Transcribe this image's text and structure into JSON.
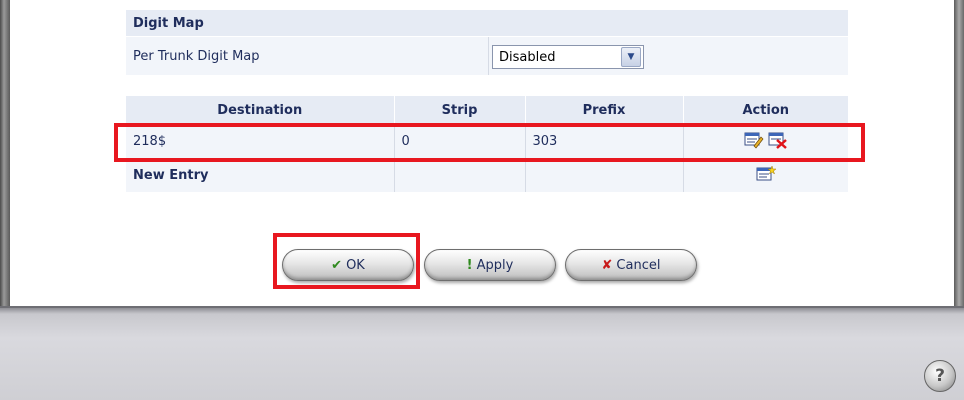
{
  "digit_map": {
    "section_title": "Digit Map",
    "per_trunk_label": "Per Trunk Digit Map",
    "per_trunk_value": "Disabled"
  },
  "table": {
    "headers": [
      "Destination",
      "Strip",
      "Prefix",
      "Action"
    ],
    "rows": [
      {
        "destination": "218$",
        "strip": "0",
        "prefix": "303"
      }
    ],
    "new_entry_label": "New Entry"
  },
  "buttons": {
    "ok": "OK",
    "apply": "Apply",
    "cancel": "Cancel"
  },
  "icons": {
    "edit": "edit-entry-icon",
    "delete": "delete-entry-icon",
    "new": "new-entry-icon",
    "help": "help-icon"
  },
  "colors": {
    "highlight": "#e8171f",
    "header_bg": "#e6ebf4",
    "row_bg": "#f2f5fa",
    "text": "#1f2d5c"
  }
}
